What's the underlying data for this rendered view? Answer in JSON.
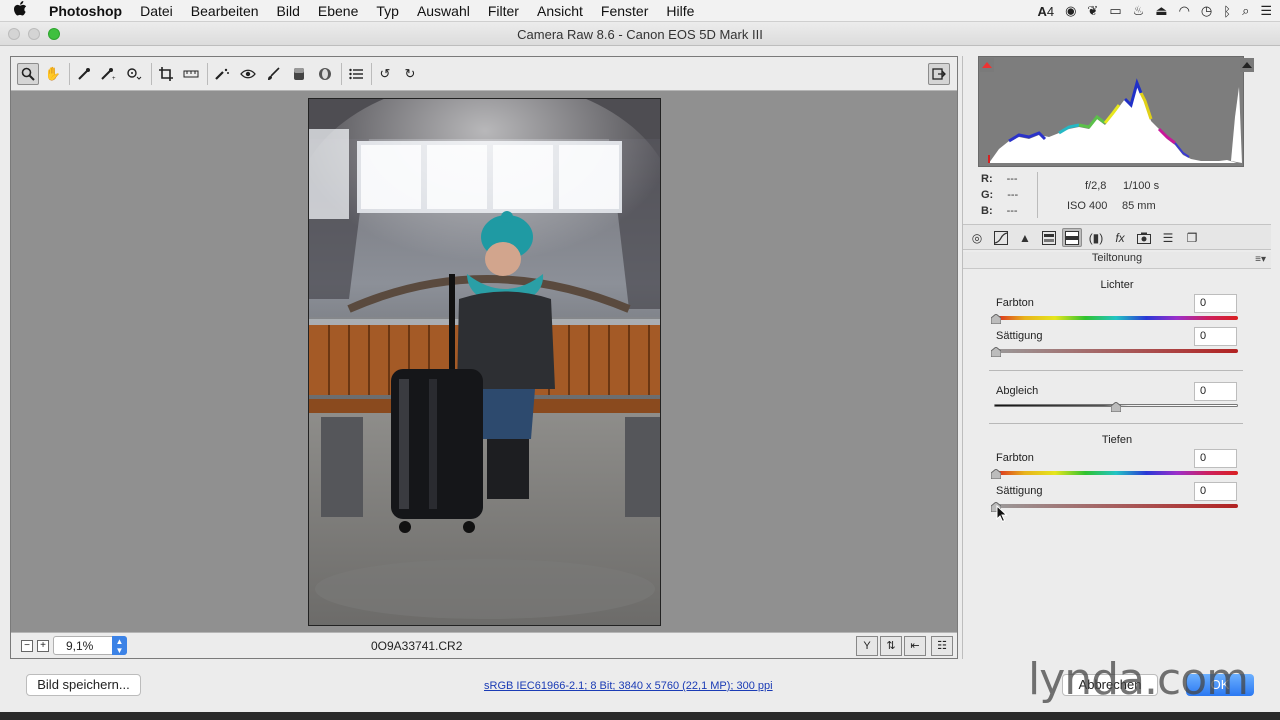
{
  "menubar": {
    "items": [
      "Photoshop",
      "Datei",
      "Bearbeiten",
      "Bild",
      "Ebene",
      "Typ",
      "Auswahl",
      "Filter",
      "Ansicht",
      "Fenster",
      "Hilfe"
    ],
    "tray_badge": "4"
  },
  "window": {
    "title": "Camera Raw 8.6 - Canon EOS 5D Mark III"
  },
  "bottom_strip": {
    "zoom_value": "9,1%",
    "filename": "0O9A33741.CR2"
  },
  "histogram": {
    "r_label": "R:",
    "g_label": "G:",
    "b_label": "B:",
    "r_value": "---",
    "g_value": "---",
    "b_value": "---",
    "aperture": "f/2,8",
    "shutter": "1/100 s",
    "iso": "ISO 400",
    "focal_length": "85 mm"
  },
  "panel": {
    "title": "Teiltonung",
    "highlights": {
      "heading": "Lichter",
      "hue_label": "Farbton",
      "hue_value": "0",
      "sat_label": "Sättigung",
      "sat_value": "0"
    },
    "balance": {
      "label": "Abgleich",
      "value": "0"
    },
    "shadows": {
      "heading": "Tiefen",
      "hue_label": "Farbton",
      "hue_value": "0",
      "sat_label": "Sättigung",
      "sat_value": "0"
    }
  },
  "footer": {
    "save_label": "Bild speichern...",
    "workflow_link": "sRGB IEC61966-2.1; 8 Bit; 3840 x 5760 (22,1 MP); 300 ppi",
    "cancel_label": "Abbrechen",
    "ok_label": "OK",
    "watermark": "lynda.com"
  }
}
